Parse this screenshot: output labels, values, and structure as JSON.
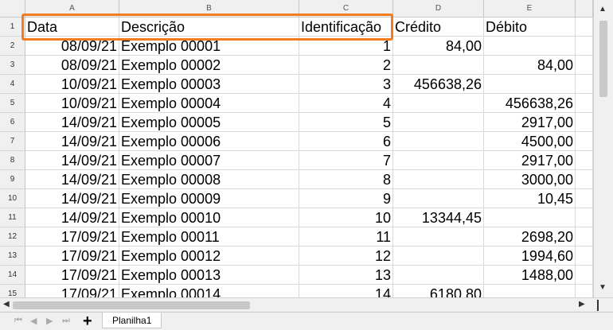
{
  "columns": [
    "A",
    "B",
    "C",
    "D",
    "E"
  ],
  "headers": [
    "Data",
    "Descrição",
    "Identificação",
    "Crédito",
    "Débito"
  ],
  "rows": [
    {
      "num": "2",
      "data": "08/09/21",
      "desc": "Exemplo 00001",
      "id": "1",
      "credito": "84,00",
      "debito": ""
    },
    {
      "num": "3",
      "data": "08/09/21",
      "desc": "Exemplo 00002",
      "id": "2",
      "credito": "",
      "debito": "84,00"
    },
    {
      "num": "4",
      "data": "10/09/21",
      "desc": "Exemplo 00003",
      "id": "3",
      "credito": "456638,26",
      "debito": ""
    },
    {
      "num": "5",
      "data": "10/09/21",
      "desc": "Exemplo 00004",
      "id": "4",
      "credito": "",
      "debito": "456638,26"
    },
    {
      "num": "6",
      "data": "14/09/21",
      "desc": "Exemplo 00005",
      "id": "5",
      "credito": "",
      "debito": "2917,00"
    },
    {
      "num": "7",
      "data": "14/09/21",
      "desc": "Exemplo 00006",
      "id": "6",
      "credito": "",
      "debito": "4500,00"
    },
    {
      "num": "8",
      "data": "14/09/21",
      "desc": "Exemplo 00007",
      "id": "7",
      "credito": "",
      "debito": "2917,00"
    },
    {
      "num": "9",
      "data": "14/09/21",
      "desc": "Exemplo 00008",
      "id": "8",
      "credito": "",
      "debito": "3000,00"
    },
    {
      "num": "10",
      "data": "14/09/21",
      "desc": "Exemplo 00009",
      "id": "9",
      "credito": "",
      "debito": "10,45"
    },
    {
      "num": "11",
      "data": "14/09/21",
      "desc": "Exemplo 00010",
      "id": "10",
      "credito": "13344,45",
      "debito": ""
    },
    {
      "num": "12",
      "data": "17/09/21",
      "desc": "Exemplo 00011",
      "id": "11",
      "credito": "",
      "debito": "2698,20"
    },
    {
      "num": "13",
      "data": "17/09/21",
      "desc": "Exemplo 00012",
      "id": "12",
      "credito": "",
      "debito": "1994,60"
    },
    {
      "num": "14",
      "data": "17/09/21",
      "desc": "Exemplo 00013",
      "id": "13",
      "credito": "",
      "debito": "1488,00"
    },
    {
      "num": "15",
      "data": "17/09/21",
      "desc": "Exemplo 00014",
      "id": "14",
      "credito": "6180,80",
      "debito": ""
    }
  ],
  "header_row_num": "1",
  "sheet_tab": "Planilha1",
  "add_sheet": "+",
  "highlight_color": "#f47c20"
}
